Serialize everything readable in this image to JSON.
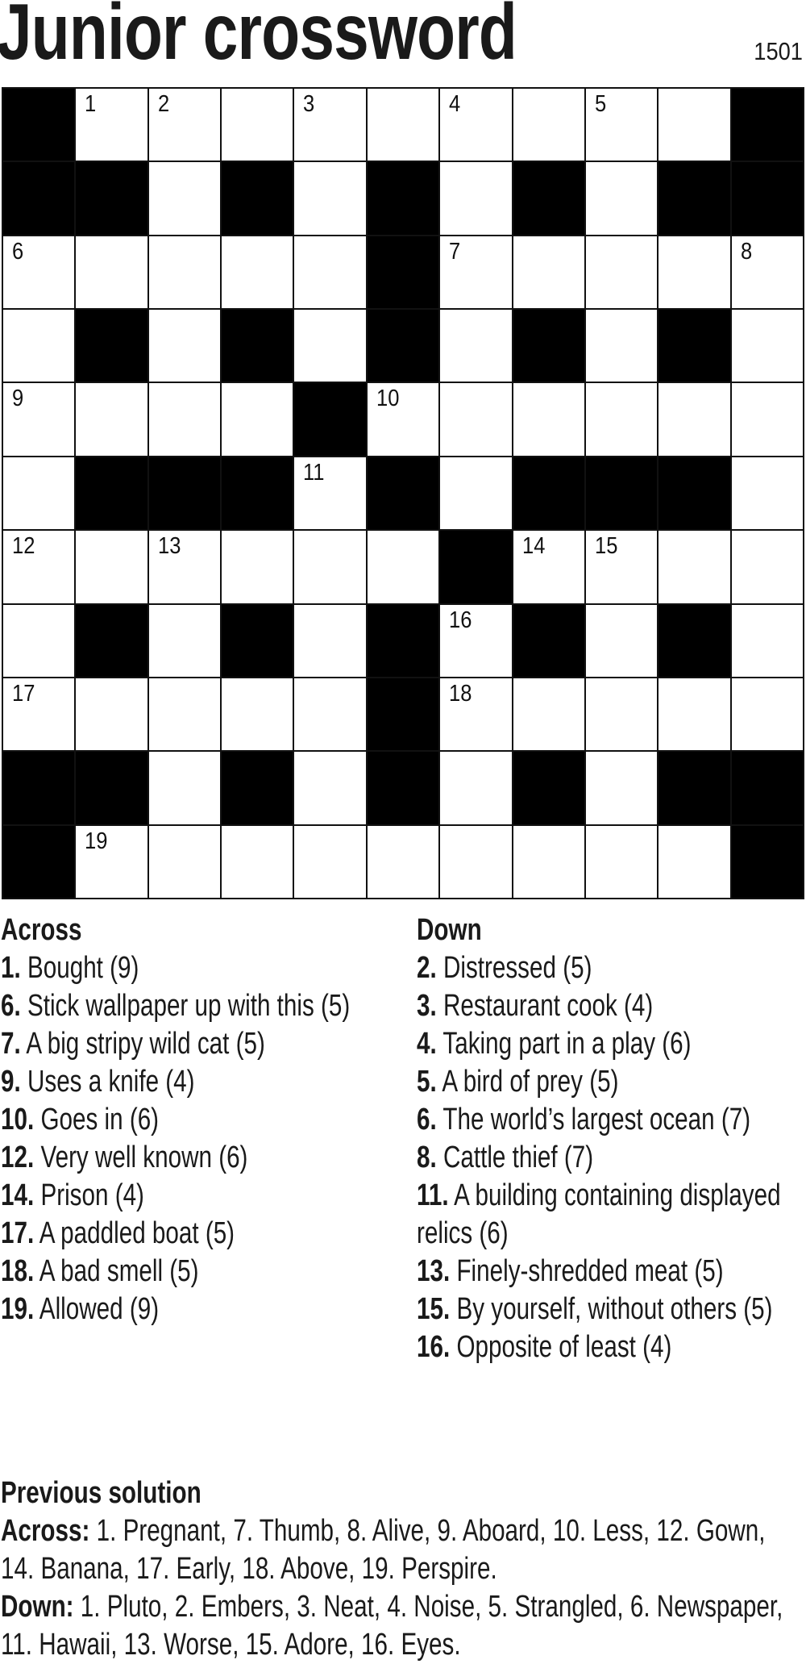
{
  "header": {
    "title": "Junior crossword",
    "puzzle_number": "1501"
  },
  "grid": {
    "rows": [
      "#.........#",
      "##.#.#.#.##",
      ".....#.....",
      ".#.#.#.#.#.",
      "....#......",
      ".###.#.###.",
      "......#....",
      ".#.#.#.#.#.",
      ".....#.....",
      "##.#.#.#.##",
      "#.........#"
    ],
    "numbers": [
      {
        "row": 0,
        "col": 1,
        "n": "1"
      },
      {
        "row": 0,
        "col": 2,
        "n": "2"
      },
      {
        "row": 0,
        "col": 4,
        "n": "3"
      },
      {
        "row": 0,
        "col": 6,
        "n": "4"
      },
      {
        "row": 0,
        "col": 8,
        "n": "5"
      },
      {
        "row": 2,
        "col": 0,
        "n": "6"
      },
      {
        "row": 2,
        "col": 6,
        "n": "7"
      },
      {
        "row": 2,
        "col": 10,
        "n": "8"
      },
      {
        "row": 4,
        "col": 0,
        "n": "9"
      },
      {
        "row": 4,
        "col": 5,
        "n": "10"
      },
      {
        "row": 5,
        "col": 4,
        "n": "11"
      },
      {
        "row": 6,
        "col": 0,
        "n": "12"
      },
      {
        "row": 6,
        "col": 2,
        "n": "13"
      },
      {
        "row": 6,
        "col": 7,
        "n": "14"
      },
      {
        "row": 6,
        "col": 8,
        "n": "15"
      },
      {
        "row": 7,
        "col": 6,
        "n": "16"
      },
      {
        "row": 8,
        "col": 0,
        "n": "17"
      },
      {
        "row": 8,
        "col": 6,
        "n": "18"
      },
      {
        "row": 10,
        "col": 1,
        "n": "19"
      }
    ]
  },
  "across": {
    "heading": "Across",
    "clues": [
      {
        "num": "1.",
        "text": "Bought (9)"
      },
      {
        "num": "6.",
        "text": "Stick wallpaper up with this (5)"
      },
      {
        "num": "7.",
        "text": "A big stripy wild cat (5)"
      },
      {
        "num": "9.",
        "text": "Uses a knife (4)"
      },
      {
        "num": "10.",
        "text": "Goes in (6)"
      },
      {
        "num": "12.",
        "text": "Very well known (6)"
      },
      {
        "num": "14.",
        "text": "Prison (4)"
      },
      {
        "num": "17.",
        "text": "A paddled boat (5)"
      },
      {
        "num": "18.",
        "text": "A bad smell (5)"
      },
      {
        "num": "19.",
        "text": "Allowed (9)"
      }
    ]
  },
  "down": {
    "heading": "Down",
    "clues": [
      {
        "num": "2.",
        "text": "Distressed (5)"
      },
      {
        "num": "3.",
        "text": "Restaurant cook (4)"
      },
      {
        "num": "4.",
        "text": "Taking part in a play (6)"
      },
      {
        "num": "5.",
        "text": "A bird of prey (5)"
      },
      {
        "num": "6.",
        "text": "The world’s largest ocean (7)"
      },
      {
        "num": "8.",
        "text": "Cattle thief (7)"
      },
      {
        "num": "11.",
        "text": "A building containing displayed relics (6)"
      },
      {
        "num": "13.",
        "text": "Finely-shredded meat (5)"
      },
      {
        "num": "15.",
        "text": "By yourself, without others (5)"
      },
      {
        "num": "16.",
        "text": "Opposite of least (4)"
      }
    ]
  },
  "previous_solution": {
    "heading": "Previous solution",
    "across_label": "Across:",
    "across_text": "1. Pregnant, 7. Thumb, 8. Alive, 9. Aboard, 10. Less, 12. Gown, 14. Banana, 17. Early, 18. Above, 19. Perspire.",
    "down_label": "Down:",
    "down_text": "1. Pluto, 2. Embers, 3. Neat, 4. Noise, 5. Strangled, 6. Newspaper, 11. Hawaii, 13. Worse, 15. Adore, 16. Eyes."
  }
}
